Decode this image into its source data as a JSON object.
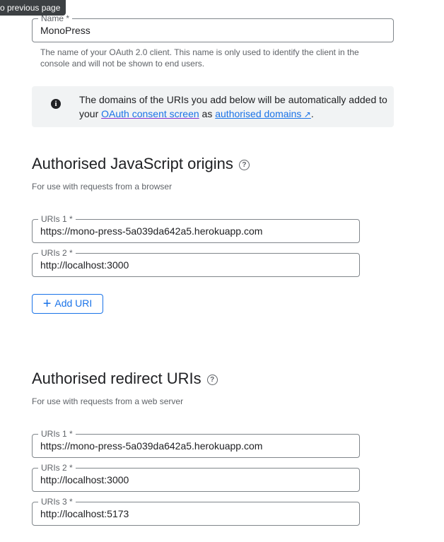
{
  "tooltip": "o previous page",
  "name_field": {
    "label": "Name *",
    "value": "MonoPress",
    "hint": "The name of your OAuth 2.0 client. This name is only used to identify the client in the console and will not be shown to end users."
  },
  "info": {
    "icon": "info-icon",
    "text_before": "The domains of the URIs you add below will be automatically added to your ",
    "link1": "OAuth consent screen",
    "text_mid": " as ",
    "link2": "authorised domains",
    "text_after": "."
  },
  "js_origins": {
    "title": "Authorised JavaScript origins",
    "subtitle": "For use with requests from a browser",
    "uris": [
      {
        "label": "URIs 1 *",
        "value": "https://mono-press-5a039da642a5.herokuapp.com"
      },
      {
        "label": "URIs 2 *",
        "value": "http://localhost:3000"
      }
    ],
    "add_label": "Add URI"
  },
  "redirect": {
    "title": "Authorised redirect URIs",
    "subtitle": "For use with requests from a web server",
    "uris": [
      {
        "label": "URIs 1 *",
        "value": "https://mono-press-5a039da642a5.herokuapp.com"
      },
      {
        "label": "URIs 2 *",
        "value": "http://localhost:3000"
      },
      {
        "label": "URIs 3 *",
        "value": "http://localhost:5173"
      }
    ]
  },
  "colors": {
    "accent": "#1a73e8",
    "text": "#202124",
    "secondary_text": "#5f6368",
    "info_bg": "#f1f3f4"
  }
}
